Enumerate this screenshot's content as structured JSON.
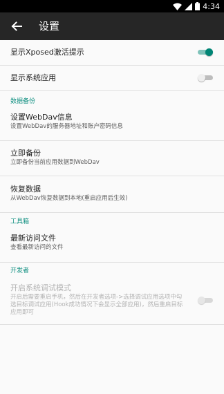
{
  "statusbar": {
    "time": "4:34"
  },
  "appbar": {
    "title": "设置"
  },
  "settings": {
    "show_xposed": {
      "title": "显示Xposed激活提示",
      "on": true
    },
    "show_system": {
      "title": "显示系统应用",
      "on": false
    }
  },
  "sections": {
    "backup": {
      "header": "数据备份",
      "webdav": {
        "title": "设置WebDav信息",
        "summary": "设置WebDav的服务器地址和账户密码信息"
      },
      "backup_now": {
        "title": "立即备份",
        "summary": "立即备份当前应用数据到WebDav"
      },
      "restore": {
        "title": "恢复数据",
        "summary": "从WebDav恢复数据到本地(重启应用后生效)"
      }
    },
    "tools": {
      "header": "工具箱",
      "recent": {
        "title": "最新访问文件",
        "summary": "查看最新访问的文件"
      }
    },
    "developer": {
      "header": "开发者",
      "debug": {
        "title": "开启系统调试模式",
        "summary": "开启后需要重启手机，然后在开发者选项->选择调试应用选项中勾选目标调试应用(Hook成功情况下会显示全部应用)，然后重启目标应用即可",
        "on": false,
        "enabled": false
      }
    }
  },
  "colors": {
    "accent": "#008575",
    "section_header": "#0f8f80",
    "appbar": "#262626"
  }
}
